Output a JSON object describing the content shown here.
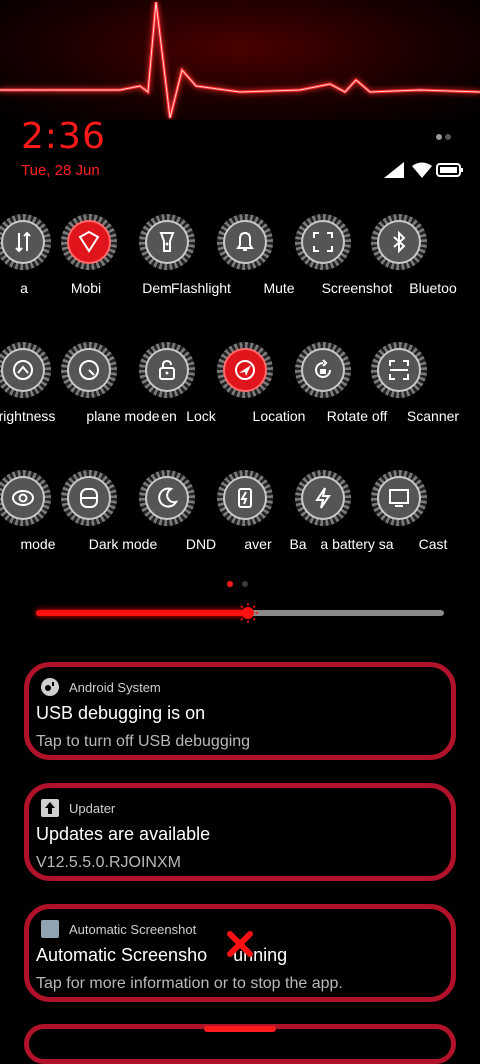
{
  "status": {
    "time": "2:36",
    "date": "Tue, 28 Jun"
  },
  "colors": {
    "accent": "#ff1a1a",
    "card_border": "#b0122a",
    "tile_on": "#e0141b",
    "tile_off": "#555555"
  },
  "quick_tiles": [
    {
      "label": "a",
      "icon": "data-arrows-icon",
      "on": false
    },
    {
      "label": "Mobi",
      "icon": "mobile-data-icon",
      "on": false
    },
    {
      "label": "Dem",
      "icon": "vpn-shield-icon",
      "on": true
    },
    {
      "label": "Flashlight",
      "icon": "flashlight-icon",
      "on": false
    },
    {
      "label": "Mute",
      "icon": "bell-icon",
      "on": false
    },
    {
      "label": "Screenshot",
      "icon": "screenshot-icon",
      "on": false
    },
    {
      "label": "Bluetoo",
      "icon": "bluetooth-icon",
      "on": false
    },
    {
      "label": "rightness",
      "icon": "brightness-auto-icon",
      "on": false
    },
    {
      "label": "plane mode",
      "icon": "airplane-mode-icon",
      "on": false
    },
    {
      "label": "en",
      "icon": "",
      "on": false
    },
    {
      "label": "Lock",
      "icon": "lock-icon",
      "on": false
    },
    {
      "label": "Location",
      "icon": "location-icon",
      "on": true
    },
    {
      "label": "Rotate off",
      "icon": "rotate-lock-icon",
      "on": false
    },
    {
      "label": "Scanner",
      "icon": "scanner-icon",
      "on": false
    },
    {
      "label": "mode",
      "icon": "eye-icon",
      "on": false
    },
    {
      "label": "Dark mode",
      "icon": "dark-mode-icon",
      "on": false
    },
    {
      "label": "DND",
      "icon": "moon-icon",
      "on": false
    },
    {
      "label": "aver",
      "icon": "battery-saver-icon",
      "on": false
    },
    {
      "label": "Ba",
      "icon": "",
      "on": false
    },
    {
      "label": "a battery sa",
      "icon": "ultra-battery-icon",
      "on": false
    },
    {
      "label": "Cast",
      "icon": "cast-icon",
      "on": false
    }
  ],
  "brightness": {
    "level": 0.52
  },
  "pager": {
    "count": 2,
    "active": 0
  },
  "notifications": [
    {
      "app": "Android System",
      "title": "USB debugging is on",
      "text": "Tap to turn off USB debugging",
      "icon": "android-system-icon"
    },
    {
      "app": "Updater",
      "title": "Updates are available",
      "text": "V12.5.5.0.RJOINXM",
      "icon": "upload-arrow-icon"
    },
    {
      "app": "Automatic Screenshot",
      "title": "Automatic Screensho",
      "title_rest": "unning",
      "text": "Tap for more information or to stop the app.",
      "icon": "app-square-icon"
    }
  ]
}
